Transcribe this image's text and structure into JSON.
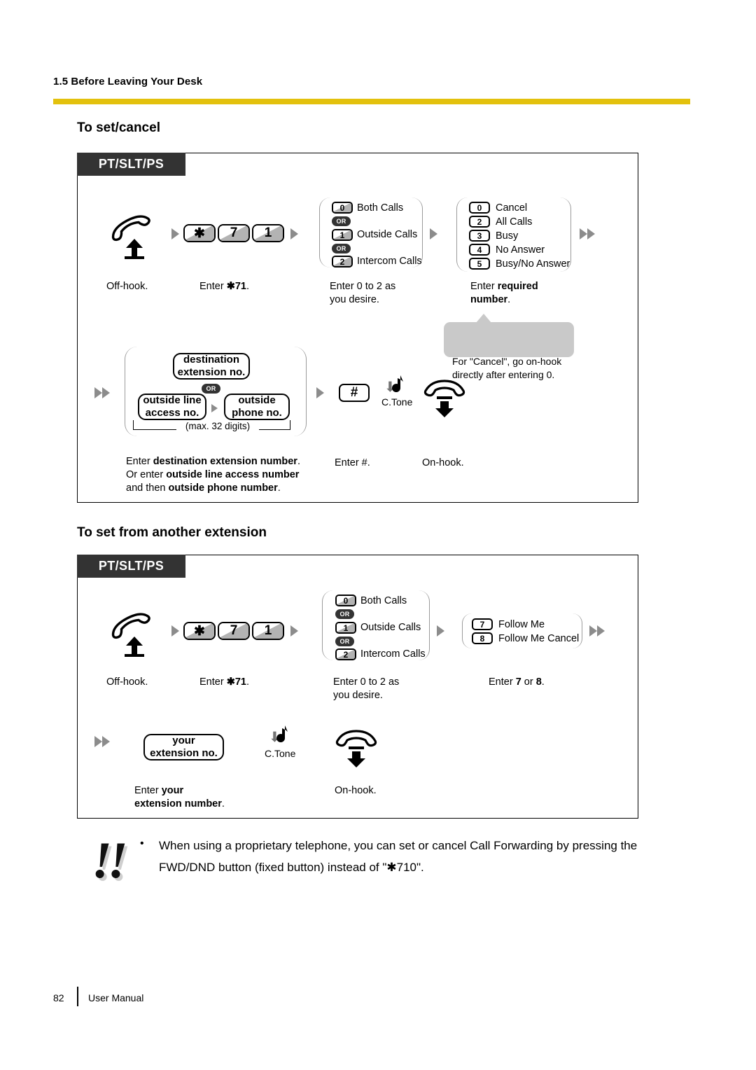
{
  "header": {
    "running_head": "1.5 Before Leaving Your Desk",
    "rule_color": "#E3C10D"
  },
  "sections": [
    {
      "heading": "To set/cancel",
      "tab_label": "PT/SLT/PS"
    },
    {
      "heading": "To set from another extension",
      "tab_label": "PT/SLT/PS"
    }
  ],
  "diagram1": {
    "row1": {
      "offhook_caption": "Off-hook.",
      "keys": [
        "✱",
        "7",
        "1"
      ],
      "keys_caption_plain_1": "Enter ",
      "keys_caption_bold": "✱71",
      "keys_caption_plain_2": ".",
      "group1": {
        "items": [
          {
            "key": "0",
            "label": "Both Calls"
          },
          {
            "key": "1",
            "label": "Outside Calls"
          },
          {
            "key": "2",
            "label": "Intercom Calls"
          }
        ],
        "or_label": "OR",
        "caption": "Enter 0 to 2 as\nyou desire."
      },
      "group2": {
        "items": [
          {
            "key": "0",
            "label": "Cancel"
          },
          {
            "key": "2",
            "label": "All Calls"
          },
          {
            "key": "3",
            "label": "Busy"
          },
          {
            "key": "4",
            "label": "No Answer"
          },
          {
            "key": "5",
            "label": "Busy/No Answer"
          }
        ],
        "caption_plain": "Enter ",
        "caption_bold": "required\nnumber",
        "caption_tail": "."
      },
      "bubble": "For \"Cancel\", go on-hook\ndirectly after entering 0."
    },
    "row2": {
      "box_destination": "destination\nextension no.",
      "or_label": "OR",
      "box_access": "outside line\naccess no.",
      "box_phone": "outside\nphone no.",
      "max_digits": "(max. 32 digits)",
      "hash_key": "#",
      "ctone_label": "C.Tone",
      "caption_line1_plain": "Enter ",
      "caption_line1_bold": "destination extension number",
      "caption_line1_tail": ".",
      "caption_line2_plain": "Or enter ",
      "caption_line2_bold": "outside line access number",
      "caption_line3_plain": "and then ",
      "caption_line3_bold": "outside phone number",
      "caption_line3_tail": ".",
      "hash_caption": "Enter #.",
      "onhook_caption": "On-hook."
    }
  },
  "diagram2": {
    "row1": {
      "offhook_caption": "Off-hook.",
      "keys": [
        "✱",
        "7",
        "1"
      ],
      "keys_caption_plain_1": "Enter ",
      "keys_caption_bold": "✱71",
      "keys_caption_plain_2": ".",
      "group1": {
        "items": [
          {
            "key": "0",
            "label": "Both Calls"
          },
          {
            "key": "1",
            "label": "Outside Calls"
          },
          {
            "key": "2",
            "label": "Intercom Calls"
          }
        ],
        "or_label": "OR",
        "caption": "Enter 0 to 2 as\nyou desire."
      },
      "group2": {
        "items": [
          {
            "key": "7",
            "label": "Follow Me"
          },
          {
            "key": "8",
            "label": "Follow Me Cancel"
          }
        ],
        "caption_plain_1": "Enter ",
        "caption_bold_1": "7",
        "caption_plain_2": " or ",
        "caption_bold_2": "8",
        "caption_tail": "."
      }
    },
    "row2": {
      "box_your_extension": "your\nextension no.",
      "ctone_label": "C.Tone",
      "caption_plain": "Enter ",
      "caption_bold": "your\nextension number",
      "caption_tail": ".",
      "onhook_caption": "On-hook."
    }
  },
  "note": {
    "icon": "!!",
    "bullet": "•",
    "text": "When using a proprietary telephone, you can set or cancel Call Forwarding by pressing the\nFWD/DND button (fixed button) instead of \"✱710\"."
  },
  "footer": {
    "page_number": "82",
    "label": "User Manual"
  }
}
